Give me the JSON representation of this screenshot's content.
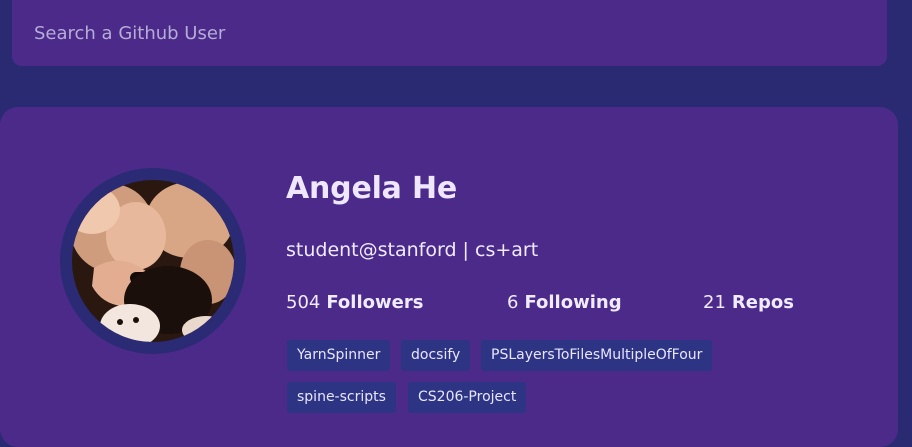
{
  "search": {
    "placeholder": "Search a Github User",
    "value": ""
  },
  "user": {
    "name": "Angela He",
    "bio": "student@stanford | cs+art",
    "stats": [
      {
        "value": "504",
        "label": "Followers"
      },
      {
        "value": "6",
        "label": "Following"
      },
      {
        "value": "21",
        "label": "Repos"
      }
    ],
    "repos": [
      "YarnSpinner",
      "docsify",
      "PSLayersToFilesMultipleOfFour",
      "spine-scripts",
      "CS206-Project"
    ]
  },
  "colors": {
    "page_bg": "#2a2a72",
    "card_bg": "#4b2a8a",
    "avatar_ring": "#2b2a75",
    "repo_bg": "#2e3484"
  }
}
